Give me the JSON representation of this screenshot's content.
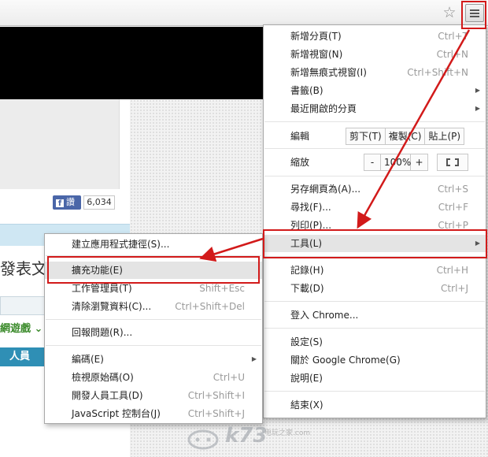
{
  "page": {
    "fb_like_label": "讚",
    "fb_like_count": "6,034",
    "heading_fragment": "發表文章",
    "green_link_fragment": "網遊戲",
    "members_label": "人員"
  },
  "menu": {
    "items": [
      {
        "label": "新增分頁(T)",
        "shortcut": "Ctrl+T"
      },
      {
        "label": "新增視窗(N)",
        "shortcut": "Ctrl+N"
      },
      {
        "label": "新增無痕式視窗(I)",
        "shortcut": "Ctrl+Shift+N"
      },
      {
        "label": "書籤(B)",
        "shortcut": ""
      },
      {
        "label": "最近開啟的分頁",
        "shortcut": ""
      },
      {
        "label": "編輯",
        "shortcut": ""
      },
      {
        "label": "縮放",
        "shortcut": ""
      },
      {
        "label": "另存網頁為(A)...",
        "shortcut": "Ctrl+S"
      },
      {
        "label": "尋找(F)...",
        "shortcut": "Ctrl+F"
      },
      {
        "label": "列印(P)...",
        "shortcut": "Ctrl+P"
      },
      {
        "label": "工具(L)",
        "shortcut": ""
      },
      {
        "label": "記錄(H)",
        "shortcut": "Ctrl+H"
      },
      {
        "label": "下載(D)",
        "shortcut": "Ctrl+J"
      },
      {
        "label": "登入 Chrome...",
        "shortcut": ""
      },
      {
        "label": "設定(S)",
        "shortcut": ""
      },
      {
        "label": "關於 Google Chrome(G)",
        "shortcut": ""
      },
      {
        "label": "說明(E)",
        "shortcut": ""
      },
      {
        "label": "結束(X)",
        "shortcut": ""
      }
    ],
    "edit_buttons": [
      "剪下(T)",
      "複製(C)",
      "貼上(P)"
    ],
    "zoom": {
      "minus": "-",
      "value": "100%",
      "plus": "+"
    }
  },
  "submenu": {
    "items": [
      {
        "label": "建立應用程式捷徑(S)...",
        "shortcut": ""
      },
      {
        "label": "擴充功能(E)",
        "shortcut": ""
      },
      {
        "label": "工作管理員(T)",
        "shortcut": "Shift+Esc"
      },
      {
        "label": "清除瀏覽資料(C)...",
        "shortcut": "Ctrl+Shift+Del"
      },
      {
        "label": "回報問題(R)...",
        "shortcut": ""
      },
      {
        "label": "編碼(E)",
        "shortcut": ""
      },
      {
        "label": "檢視原始碼(O)",
        "shortcut": "Ctrl+U"
      },
      {
        "label": "開發人員工具(D)",
        "shortcut": "Ctrl+Shift+I"
      },
      {
        "label": "JavaScript 控制台(J)",
        "shortcut": "Ctrl+Shift+J"
      }
    ]
  },
  "watermark": {
    "brand": "k73",
    "tagline": "电玩之家",
    "domain": ".com"
  },
  "colors": {
    "highlight_red": "#d21a1a",
    "menu_hover": "#e4e4e4",
    "shortcut_gray": "#9a9a9a"
  }
}
